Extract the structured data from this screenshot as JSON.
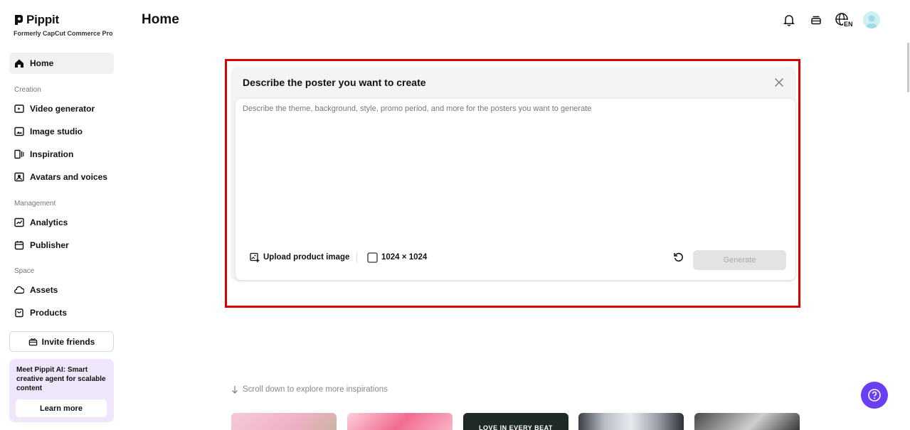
{
  "brand": {
    "name": "Pippit",
    "subtitle": "Formerly CapCut Commerce Pro"
  },
  "sidebar": {
    "home": "Home",
    "sections": {
      "creation": "Creation",
      "management": "Management",
      "space": "Space"
    },
    "creation_items": [
      {
        "label": "Video generator",
        "icon": "video-generator-icon"
      },
      {
        "label": "Image studio",
        "icon": "image-studio-icon"
      },
      {
        "label": "Inspiration",
        "icon": "inspiration-icon"
      },
      {
        "label": "Avatars and voices",
        "icon": "avatar-voice-icon"
      }
    ],
    "management_items": [
      {
        "label": "Analytics",
        "icon": "analytics-icon"
      },
      {
        "label": "Publisher",
        "icon": "calendar-icon"
      }
    ],
    "space_items": [
      {
        "label": "Assets",
        "icon": "cloud-icon"
      },
      {
        "label": "Products",
        "icon": "bag-icon"
      }
    ],
    "invite_label": "Invite friends",
    "promo": {
      "text": "Meet Pippit AI: Smart creative agent for scalable content",
      "button": "Learn more"
    }
  },
  "header": {
    "title": "Home",
    "language": "EN",
    "icons": [
      "bell-icon",
      "stack-icon",
      "globe-language-icon",
      "avatar"
    ]
  },
  "modal": {
    "title": "Describe the poster you want to create",
    "prompt_placeholder": "Describe the theme, background, style, promo period, and more for the posters you want to generate",
    "prompt_value": "",
    "upload_label": "Upload product image",
    "size_label": "1024 × 1024",
    "generate_label": "Generate"
  },
  "explore": {
    "scroll_hint": "Scroll down to explore more inspirations",
    "thumbnails": [
      {
        "text": ""
      },
      {
        "text": ""
      },
      {
        "text": "LOVE IN EVERY BEAT"
      },
      {
        "text": ""
      },
      {
        "text": ""
      }
    ]
  },
  "colors": {
    "highlight": "#d90000",
    "help_button": "#6b3df5",
    "promo_bg": "#efe6fb"
  }
}
